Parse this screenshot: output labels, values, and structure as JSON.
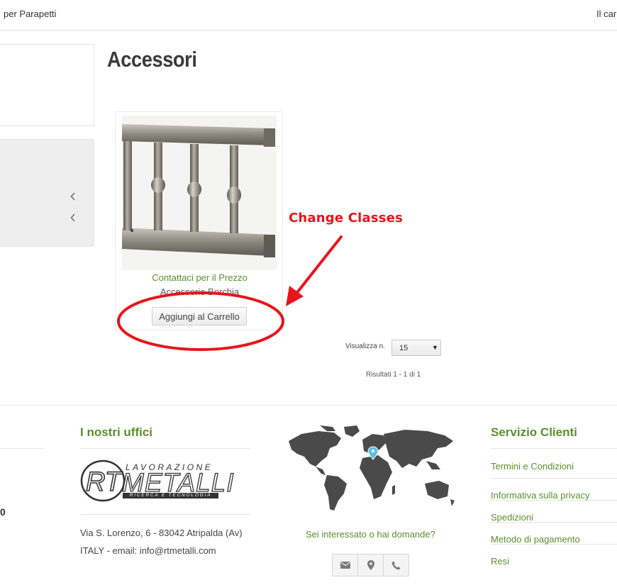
{
  "topbar": {
    "nav_left": "per Parapetti",
    "nav_right": "Il car"
  },
  "page": {
    "title": "Accessori"
  },
  "product": {
    "price_link": "Contattaci per il Prezzo",
    "name": "Accessorio Borchia",
    "add_to_cart_label": "Aggiungi al Carrello"
  },
  "annotation": {
    "label": "Change Classes",
    "color": "#e8141b"
  },
  "pagination": {
    "per_page_label": "Visualizza n.",
    "per_page_value": "15",
    "results_text": "Risultati 1 - 1 di 1"
  },
  "footer": {
    "left_fragment": "0",
    "offices": {
      "title": "I nostri uffici",
      "logo": {
        "line1": "LAVORAZIONE",
        "line2": "METALLI",
        "line3": "RICERCA E TECNOLOGIA",
        "monogram": "RT"
      },
      "address_line1": "Via S. Lorenzo, 6 - 83042 Atripalda (Av)",
      "address_line2": "ITALY - email: info@rtmetalli.com"
    },
    "contact": {
      "question": "Sei interessato o hai domande?",
      "buttons": [
        "envelope-icon",
        "map-marker-icon",
        "phone-icon"
      ]
    },
    "service": {
      "title": "Servizio Clienti",
      "links": [
        "Termini e Condizioni",
        "Informativa sulla privacy",
        "Spedizioni",
        "Metodo di pagamento",
        "Resi"
      ]
    }
  },
  "colors": {
    "accent_green": "#5a8f2c",
    "map_gray": "#4a4a4a",
    "map_pin": "#5bc0de"
  }
}
